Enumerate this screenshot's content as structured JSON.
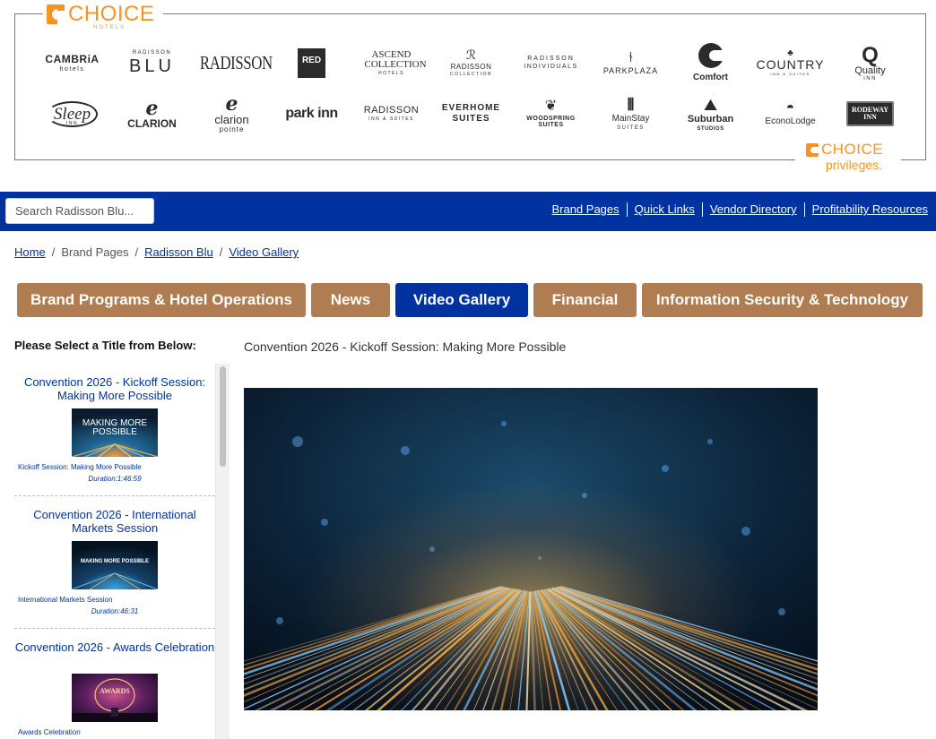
{
  "header": {
    "choice_logo_word": "CHOICE",
    "choice_logo_sub": "HOTELS",
    "privileges_word": "CHOICE",
    "privileges_sub": "privileges.",
    "brand_row_1": [
      {
        "name": "CAMBRiA",
        "sub": "hotels"
      },
      {
        "name": "BLU",
        "sub": "RADISSON"
      },
      {
        "name": "RADISSON",
        "sub": ""
      },
      {
        "name": "RED",
        "sub": ""
      },
      {
        "name": "ASCEND COLLECTION",
        "sub": "HOTELS"
      },
      {
        "name": "RADISSON",
        "sub": "COLLECTION"
      },
      {
        "name": "RADISSON",
        "sub": "INDIVIDUALS"
      },
      {
        "name": "PARKPLAZA",
        "sub": ""
      },
      {
        "name": "Comfort",
        "sub": ""
      },
      {
        "name": "COUNTRY",
        "sub": "INN & SUITES"
      },
      {
        "name": "Quality",
        "sub": "INN"
      }
    ],
    "brand_row_2": [
      {
        "name": "Sleep",
        "sub": "INN"
      },
      {
        "name": "CLARION",
        "sub": ""
      },
      {
        "name": "clarion",
        "sub": "pointe"
      },
      {
        "name": "park inn",
        "sub": ""
      },
      {
        "name": "RADISSON",
        "sub": "INN & SUITES"
      },
      {
        "name": "EVERHOME",
        "sub": "SUITES"
      },
      {
        "name": "WOODSPRING",
        "sub": "SUITES"
      },
      {
        "name": "MainStay",
        "sub": "SUITES"
      },
      {
        "name": "Suburban",
        "sub": "STUDIOS"
      },
      {
        "name": "EconoLodge",
        "sub": ""
      },
      {
        "name": "RODEWAY",
        "sub": "INN"
      }
    ]
  },
  "navbar": {
    "search_placeholder": "Search Radisson Blu...",
    "links": [
      "Brand Pages",
      "Quick Links",
      "Vendor Directory",
      "Profitability Resources"
    ]
  },
  "breadcrumb": {
    "home": "Home",
    "brand_pages": "Brand Pages",
    "radisson_blu": "Radisson Blu",
    "video_gallery": "Video Gallery",
    "separator": "/"
  },
  "tabs": [
    {
      "label": "Brand Programs & Hotel Operations",
      "active": false
    },
    {
      "label": "News",
      "active": false
    },
    {
      "label": "Video Gallery",
      "active": true
    },
    {
      "label": "Financial",
      "active": false
    },
    {
      "label": "Information Security & Technology",
      "active": false
    }
  ],
  "sidebar": {
    "heading": "Please Select a Title from Below:",
    "videos": [
      {
        "title": "Convention 2026 - Kickoff Session: Making More Possible",
        "desc": "Kickoff Session: Making More Possible",
        "duration": "Duration:1:46:59",
        "thumb_text": "MAKING MORE POSSIBLE"
      },
      {
        "title": "Convention 2026 - International Markets Session",
        "desc": "International Markets Session",
        "duration": "Duration:46:31",
        "thumb_text": "MAKING MORE POSSIBLE"
      },
      {
        "title": "Convention 2026 - Awards Celebration",
        "desc": "Awards Celebration",
        "duration": "",
        "thumb_text": "AWARDS"
      }
    ]
  },
  "main": {
    "video_title": "Convention 2026 - Kickoff Session: Making More Possible"
  },
  "colors": {
    "nav_blue": "#0033a0",
    "tab_brown": "#b07d52",
    "choice_orange": "#f7941d"
  }
}
